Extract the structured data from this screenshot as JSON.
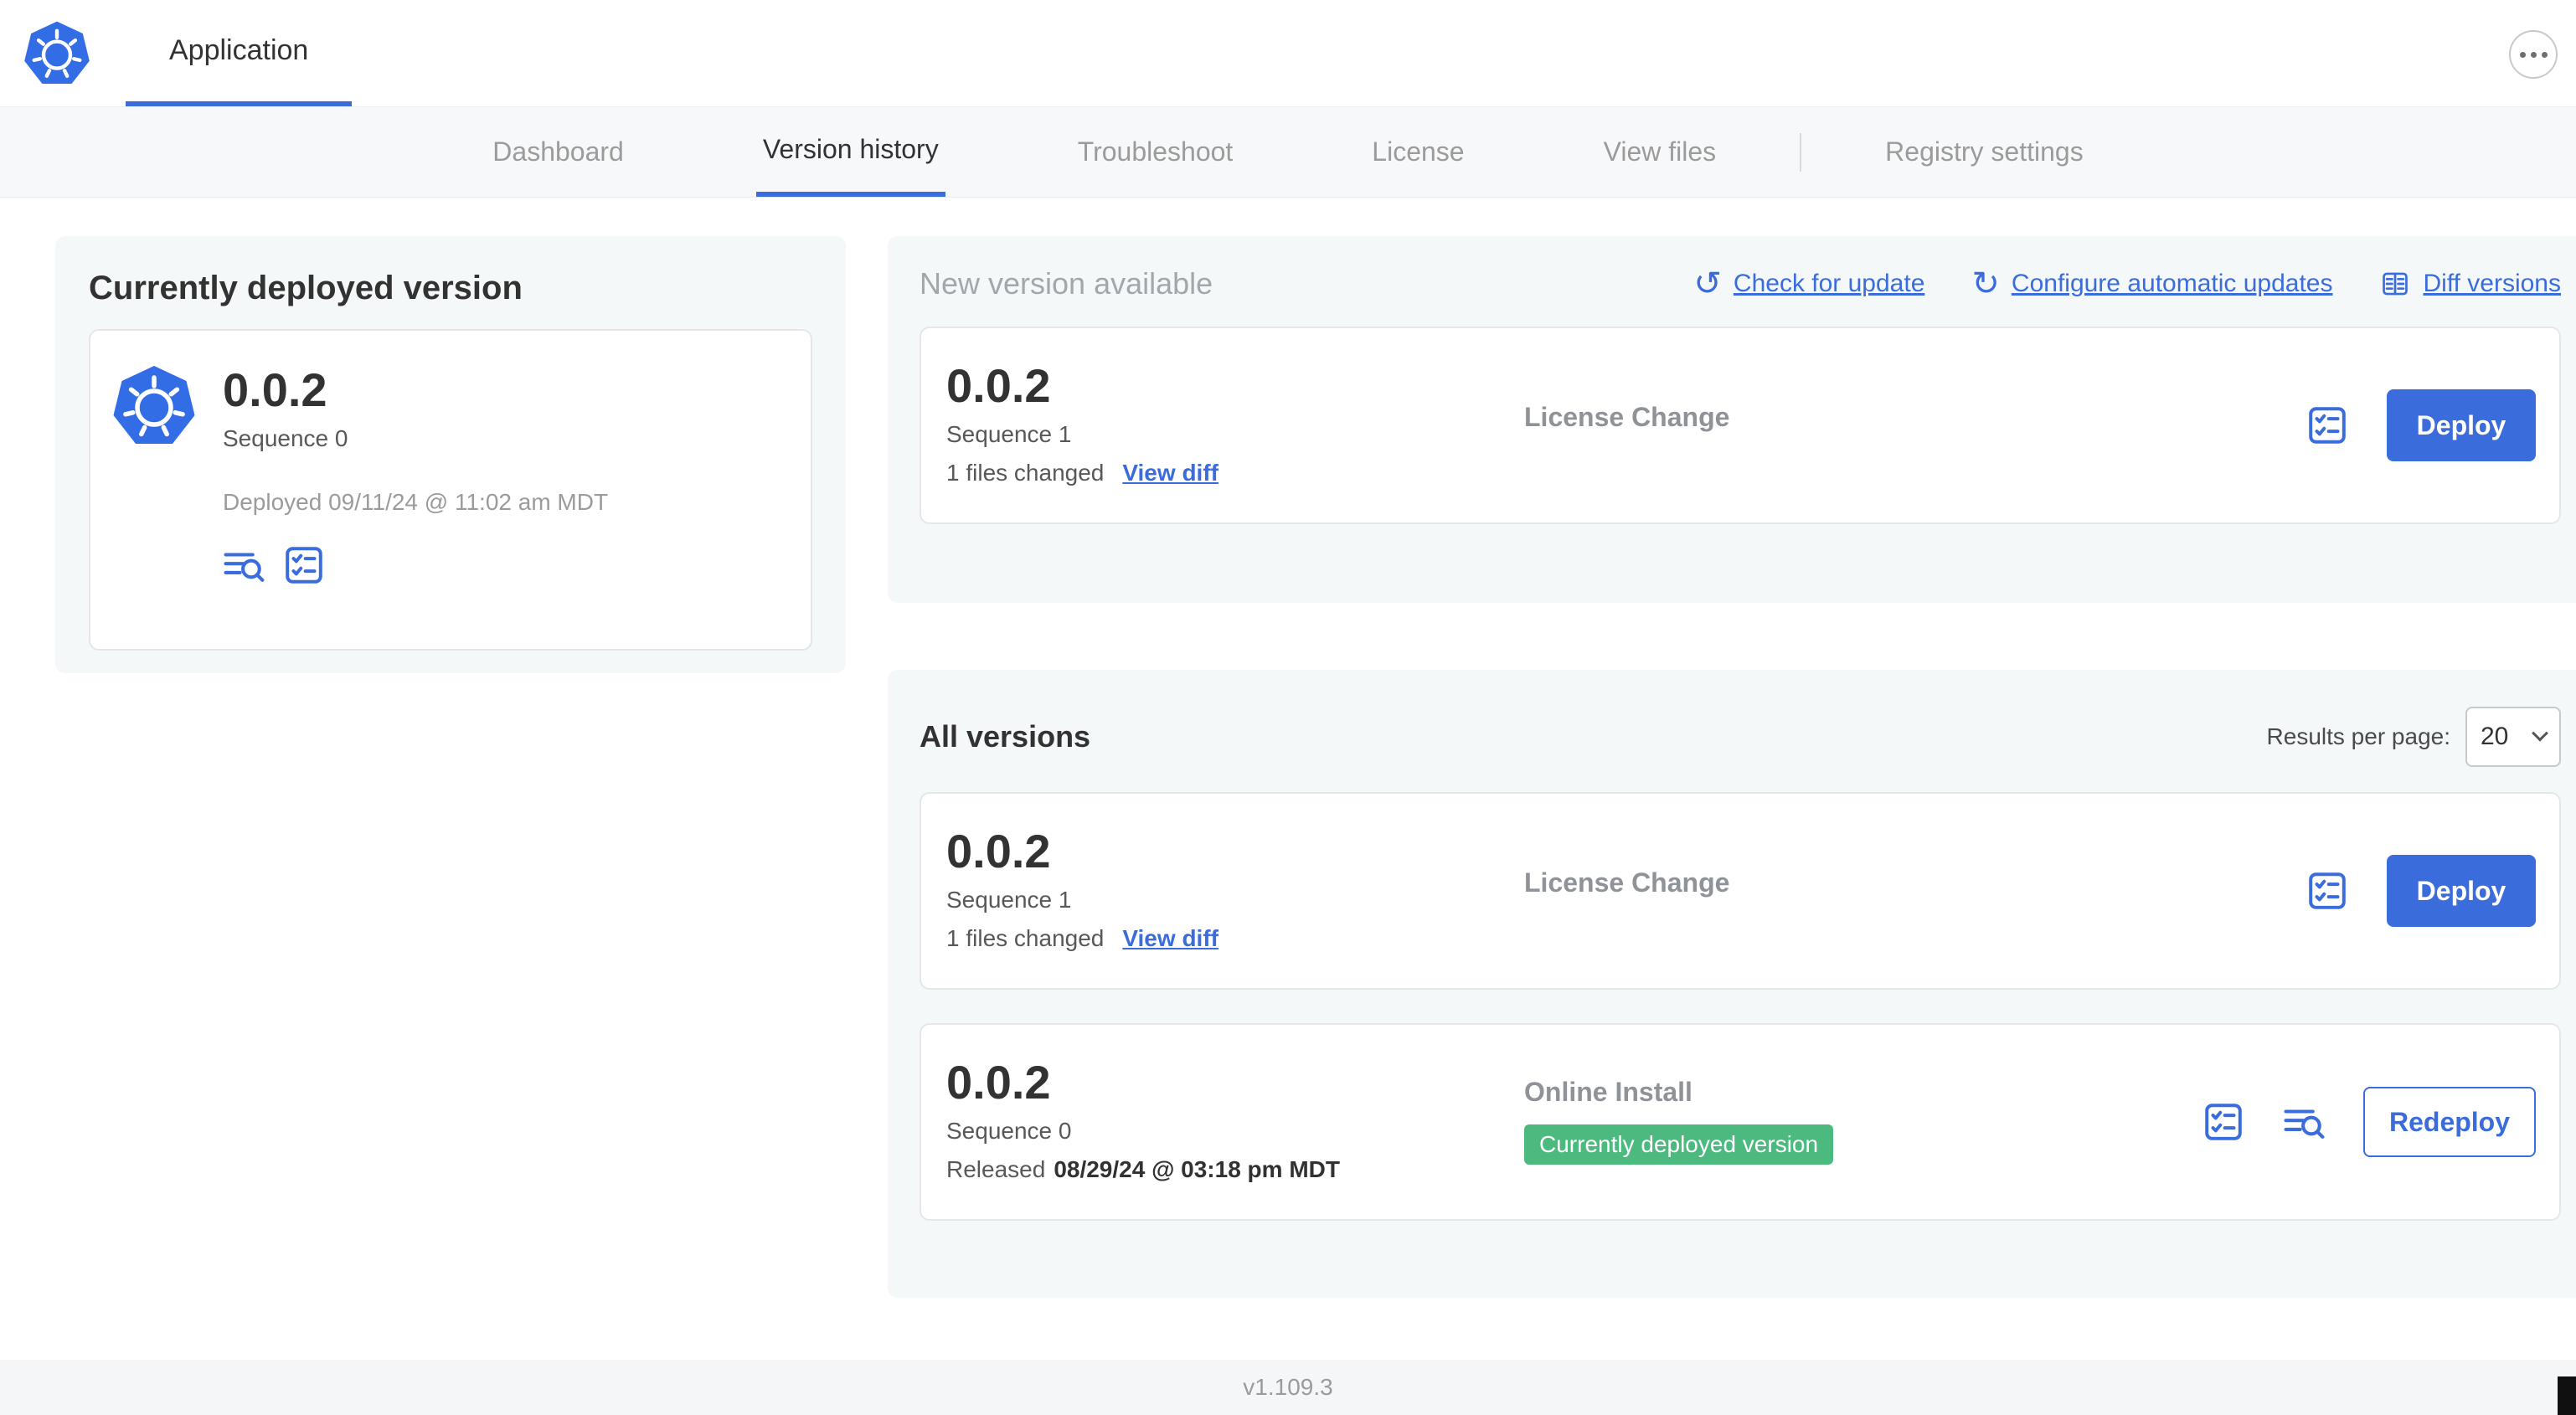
{
  "header": {
    "app_tab_label": "Application"
  },
  "nav": {
    "tabs": [
      "Dashboard",
      "Version history",
      "Troubleshoot",
      "License",
      "View files",
      "Registry settings"
    ],
    "active_tab": "Version history"
  },
  "icons": {
    "check_update_glyph": "↺",
    "auto_update_glyph": "↻"
  },
  "deployed_panel": {
    "title": "Currently deployed version",
    "version": "0.0.2",
    "sequence": "Sequence 0",
    "deployed_at": "Deployed 09/11/24 @ 11:02 am MDT"
  },
  "new_version_panel": {
    "title": "New version available",
    "check_for_update": "Check for update",
    "configure_automatic_updates": "Configure automatic updates",
    "diff_versions": "Diff versions",
    "card": {
      "version": "0.0.2",
      "sequence": "Sequence 1",
      "files_changed": "1 files changed",
      "view_diff": "View diff",
      "source": "License Change",
      "deploy_label": "Deploy"
    }
  },
  "all_versions": {
    "title": "All versions",
    "results_per_page_label": "Results per page:",
    "results_per_page_value": "20",
    "rows": [
      {
        "version": "0.0.2",
        "sequence": "Sequence 1",
        "files_changed": "1 files changed",
        "view_diff": "View diff",
        "source": "License Change",
        "action": "Deploy"
      },
      {
        "version": "0.0.2",
        "sequence": "Sequence 0",
        "released_label": "Released",
        "released_date": "08/29/24 @ 03:18 pm MDT",
        "source": "Online Install",
        "badge": "Currently deployed version",
        "action": "Redeploy"
      }
    ]
  },
  "footer": {
    "version_label": "v1.109.3"
  },
  "colors": {
    "accent_blue": "#3b6cdc",
    "badge_green": "#4cba7f",
    "panel_bg": "#f5f8f9",
    "muted_text": "#9b9b9b",
    "k8s_blue": "#326de6"
  }
}
